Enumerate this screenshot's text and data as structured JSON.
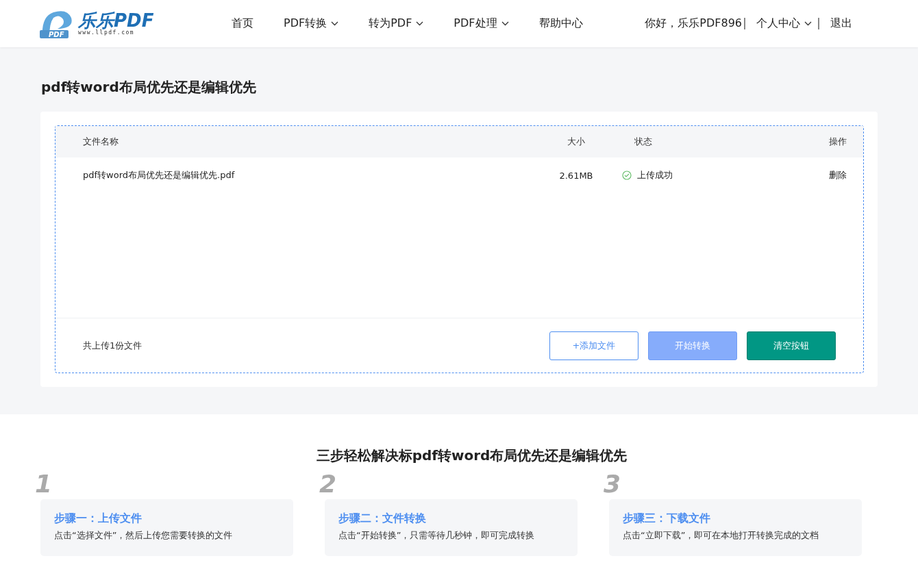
{
  "header": {
    "logo": {
      "mark": "PDF",
      "name": "乐乐PDF",
      "url": "www.llpdf.com"
    },
    "nav": [
      {
        "label": "首页",
        "dropdown": false
      },
      {
        "label": "PDF转换",
        "dropdown": true
      },
      {
        "label": "转为PDF",
        "dropdown": true
      },
      {
        "label": "PDF处理",
        "dropdown": true
      },
      {
        "label": "帮助中心",
        "dropdown": false
      }
    ],
    "greeting": "你好，乐乐PDF896",
    "account": "个人中心",
    "logout": "退出"
  },
  "page_title": "pdf转word布局优先还是编辑优先",
  "table": {
    "columns": [
      "文件名称",
      "大小",
      "状态",
      "操作"
    ],
    "rows": [
      {
        "name": "pdf转word布局优先还是编辑优先.pdf",
        "size": "2.61MB",
        "status": "上传成功",
        "action": "删除"
      }
    ]
  },
  "summary": "共上传1份文件",
  "buttons": [
    {
      "label": "+添加文件",
      "kind": "outline"
    },
    {
      "label": "开始转换",
      "kind": "light"
    },
    {
      "label": "清空按钮",
      "kind": "primary"
    }
  ],
  "steps_title": "三步轻松解决标pdf转word布局优先还是编辑优先",
  "steps": [
    {
      "number": "1",
      "title": "步骤一：上传文件",
      "text": "点击“选择文件”，然后上传您需要转换的文件"
    },
    {
      "number": "2",
      "title": "步骤二：文件转换",
      "text": "点击“开始转换”，只需等待几秒钟，即可完成转换"
    },
    {
      "number": "3",
      "title": "步骤三：下载文件",
      "text": "点击“立即下载”，即可在本地打开转换完成的文档"
    }
  ]
}
